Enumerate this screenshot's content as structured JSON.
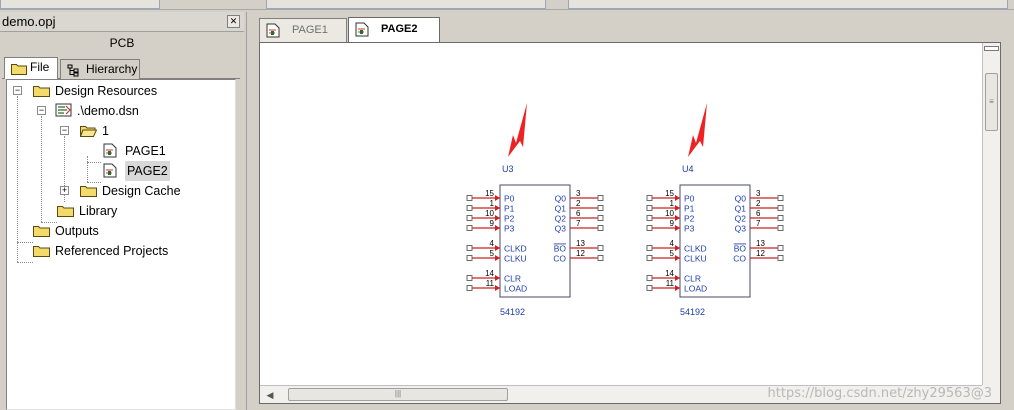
{
  "project_panel": {
    "title": "demo.opj",
    "subtitle": "PCB",
    "tabs": [
      {
        "label": "File",
        "icon": "folder-icon"
      },
      {
        "label": "Hierarchy",
        "icon": "hierarchy-icon"
      }
    ],
    "tree": {
      "design_resources": "Design Resources",
      "design_file": ".\\demo.dsn",
      "schematic_folder": "1",
      "page1": "PAGE1",
      "page2": "PAGE2",
      "design_cache": "Design Cache",
      "library": "Library",
      "outputs": "Outputs",
      "referenced_projects": "Referenced Projects"
    }
  },
  "document": {
    "tabs": [
      {
        "label": "PAGE1",
        "active": false
      },
      {
        "label": "PAGE2",
        "active": true
      }
    ],
    "watermark": "https://blog.csdn.net/zhy29563@3"
  },
  "schematic": {
    "accent_arrow_color": "#ee2222",
    "pin_color": "#cc2222",
    "text_color": "#1f3ea8",
    "parts": [
      {
        "refdes": "U3",
        "value": "54192",
        "left_pins": [
          {
            "num": "15",
            "name": "P0"
          },
          {
            "num": "1",
            "name": "P1"
          },
          {
            "num": "10",
            "name": "P2"
          },
          {
            "num": "9",
            "name": "P3"
          },
          {
            "num": "4",
            "name": "CLKD"
          },
          {
            "num": "5",
            "name": "CLKU"
          },
          {
            "num": "14",
            "name": "CLR"
          },
          {
            "num": "11",
            "name": "LOAD"
          }
        ],
        "right_pins": [
          {
            "num": "3",
            "name": "Q0"
          },
          {
            "num": "2",
            "name": "Q1"
          },
          {
            "num": "6",
            "name": "Q2"
          },
          {
            "num": "7",
            "name": "Q3"
          },
          {
            "num": "13",
            "name": "BO"
          },
          {
            "num": "12",
            "name": "CO"
          }
        ]
      },
      {
        "refdes": "U4",
        "value": "54192",
        "left_pins": [
          {
            "num": "15",
            "name": "P0"
          },
          {
            "num": "1",
            "name": "P1"
          },
          {
            "num": "10",
            "name": "P2"
          },
          {
            "num": "9",
            "name": "P3"
          },
          {
            "num": "4",
            "name": "CLKD"
          },
          {
            "num": "5",
            "name": "CLKU"
          },
          {
            "num": "14",
            "name": "CLR"
          },
          {
            "num": "11",
            "name": "LOAD"
          }
        ],
        "right_pins": [
          {
            "num": "3",
            "name": "Q0"
          },
          {
            "num": "2",
            "name": "Q1"
          },
          {
            "num": "6",
            "name": "Q2"
          },
          {
            "num": "7",
            "name": "Q3"
          },
          {
            "num": "13",
            "name": "BO"
          },
          {
            "num": "12",
            "name": "CO"
          }
        ]
      }
    ]
  }
}
